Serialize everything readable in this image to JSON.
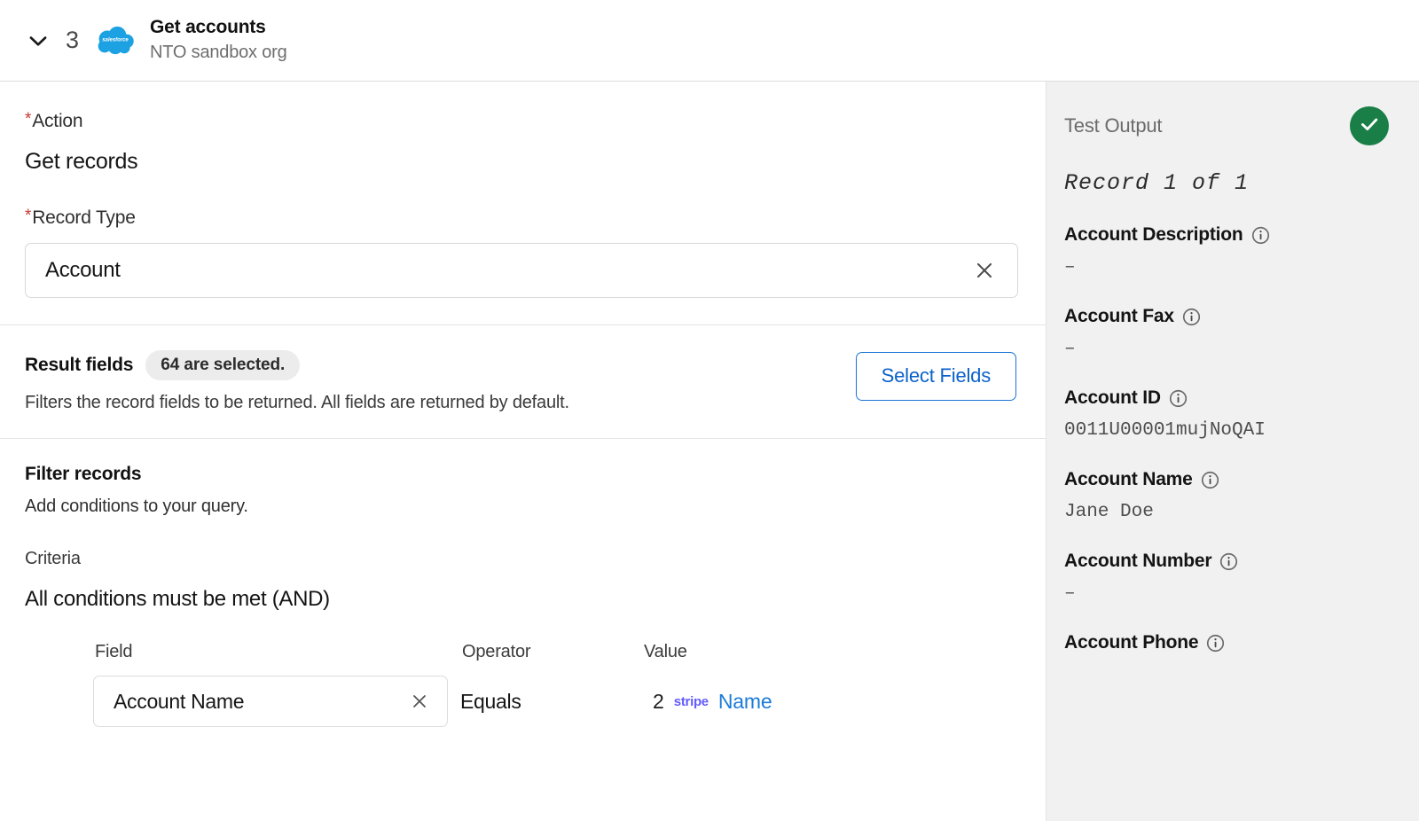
{
  "header": {
    "chevron_icon": "chevron-down-icon",
    "step_number": "3",
    "app_icon": "salesforce-cloud-icon",
    "title": "Get accounts",
    "subtitle": "NTO sandbox org"
  },
  "left_pane": {
    "action": {
      "required_mark": "*",
      "label": "Action",
      "value": "Get records"
    },
    "record_type": {
      "required_mark": "*",
      "label": "Record Type",
      "value": "Account",
      "clear_icon": "close-x-icon"
    },
    "result_fields": {
      "title": "Result fields",
      "badge": "64 are selected.",
      "help": "Filters the record fields to be returned. All fields are returned by default.",
      "button_label": "Select Fields"
    },
    "filter_records": {
      "title": "Filter records",
      "help": "Add conditions to your query.",
      "criteria_label": "Criteria",
      "criteria_value": "All conditions must be met (AND)",
      "columns": {
        "field": "Field",
        "operator": "Operator",
        "value": "Value"
      },
      "condition": {
        "field_value": "Account Name",
        "field_clear_icon": "close-x-icon",
        "operator_value": "Equals",
        "value_step_index": "2",
        "value_brand": "stripe",
        "value_link": "Name"
      }
    }
  },
  "right_pane": {
    "title": "Test Output",
    "status_icon": "success-check-icon",
    "status_color": "#1a7f47",
    "record_count": "Record 1 of 1",
    "fields": [
      {
        "label": "Account Description",
        "info_icon": "info-icon",
        "value": "–"
      },
      {
        "label": "Account Fax",
        "info_icon": "info-icon",
        "value": "–"
      },
      {
        "label": "Account ID",
        "info_icon": "info-icon",
        "value": "0011U00001mujNoQAI"
      },
      {
        "label": "Account Name",
        "info_icon": "info-icon",
        "value": "Jane Doe"
      },
      {
        "label": "Account Number",
        "info_icon": "info-icon",
        "value": "–"
      },
      {
        "label": "Account Phone",
        "info_icon": "info-icon",
        "value": ""
      }
    ]
  },
  "colors": {
    "brand_stripe": "#635bff",
    "link_blue": "#1b7bd8",
    "button_blue": "#0b62cb",
    "required_red": "#c23934",
    "success_green": "#1a7f47",
    "panel_bg": "#f1f1f1"
  }
}
